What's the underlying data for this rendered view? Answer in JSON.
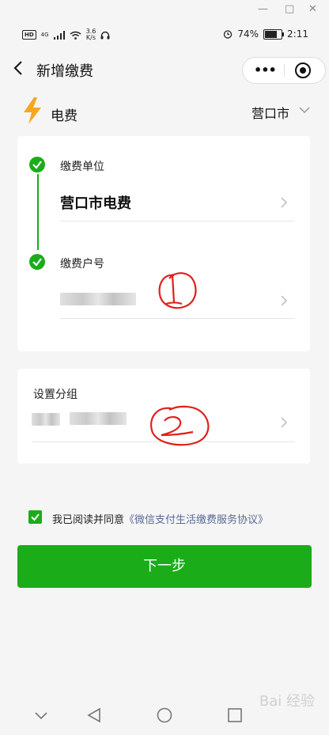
{
  "window_controls": {
    "minimize": "—",
    "maximize": "□",
    "close": "✕"
  },
  "status_bar": {
    "hd_badge": "HD",
    "net": "4G",
    "speed_value": "3.6",
    "speed_unit": "K/s",
    "battery_percent": "74%",
    "battery_level": 0.74,
    "time": "2:11",
    "icons": [
      "signal-icon",
      "wifi-icon",
      "headset-icon",
      "alarm-icon",
      "battery-icon"
    ]
  },
  "navbar": {
    "title": "新增缴费",
    "more_label": "•••"
  },
  "service": {
    "name": "电费",
    "city": "营口市",
    "icon": "lightning-bolt-icon",
    "accent": "#f5a623"
  },
  "payment": {
    "unit_label": "缴费单位",
    "unit_value": "营口市电费",
    "account_label": "缴费户号"
  },
  "group": {
    "label": "设置分组"
  },
  "agreement": {
    "prefix": "我已阅读并同意",
    "link": "《微信支付生活缴费服务协议》",
    "checked": true
  },
  "primary_button": {
    "label": "下一步",
    "color": "#1aad19"
  },
  "annotations": [
    "1",
    "2"
  ],
  "watermark": "Bai 经验"
}
